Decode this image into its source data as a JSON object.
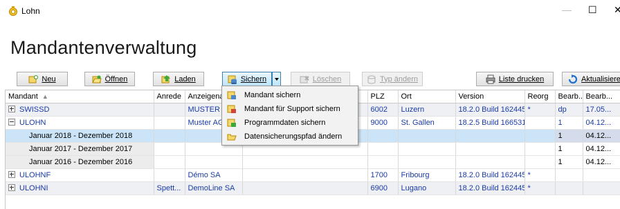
{
  "window": {
    "title": "Lohn",
    "controls": {
      "min": "—",
      "max": "☐",
      "close": "✕"
    }
  },
  "page_title": "Mandantenverwaltung",
  "toolbar": {
    "new": "Neu",
    "open": "Öffnen",
    "load": "Laden",
    "save": "Sichern",
    "delete": "Löschen",
    "change_type": "Typ ändern",
    "print_list": "Liste drucken",
    "refresh": "Aktualisieren"
  },
  "save_menu": [
    "Mandant sichern",
    "Mandant für Support sichern",
    "Programmdaten sichern",
    "Datensicherungspfad ändern"
  ],
  "columns": [
    "Mandant",
    "Anrede",
    "Anzeigenam",
    "",
    "PLZ",
    "Ort",
    "Version",
    "Reorg",
    "Bearb...",
    "Bearb..."
  ],
  "rows": [
    {
      "mandant": "SWISSD",
      "anrede": "",
      "anzeige": "MUSTER A",
      "plz": "6002",
      "ort": "Luzern",
      "version": "18.2.0 Build 162445",
      "reorg": "*",
      "bearb1": "dp",
      "bearb2": "17.05..."
    },
    {
      "mandant": "ULOHN",
      "anrede": "",
      "anzeige": "Muster AG",
      "plz": "9000",
      "ort": "St. Gallen",
      "version": "18.2.5 Build 166531",
      "reorg": "",
      "bearb1": "1",
      "bearb2": "04.12..."
    },
    {
      "mandant": "Januar 2018 - Dezember 2018",
      "bearb1": "1",
      "bearb2": "04.12..."
    },
    {
      "mandant": "Januar 2017 - Dezember 2017",
      "bearb1": "1",
      "bearb2": "04.12..."
    },
    {
      "mandant": "Januar 2016 - Dezember 2016",
      "bearb1": "1",
      "bearb2": "04.12..."
    },
    {
      "mandant": "ULOHNF",
      "anrede": "",
      "anzeige": "Démo SA",
      "plz": "1700",
      "ort": "Fribourg",
      "version": "18.2.0 Build 162445",
      "reorg": "*",
      "bearb1": "",
      "bearb2": ""
    },
    {
      "mandant": "ULOHNI",
      "anrede": "Spett...",
      "anzeige": "DemoLine SA",
      "plz": "6900",
      "ort": "Lugano",
      "version": "18.2.0 Build 162445",
      "reorg": "*",
      "bearb1": "",
      "bearb2": ""
    }
  ],
  "colors": {
    "parent_text": "#1a3aa6",
    "selection": "#cce4f7",
    "menu_bg": "#f2f2f2"
  }
}
